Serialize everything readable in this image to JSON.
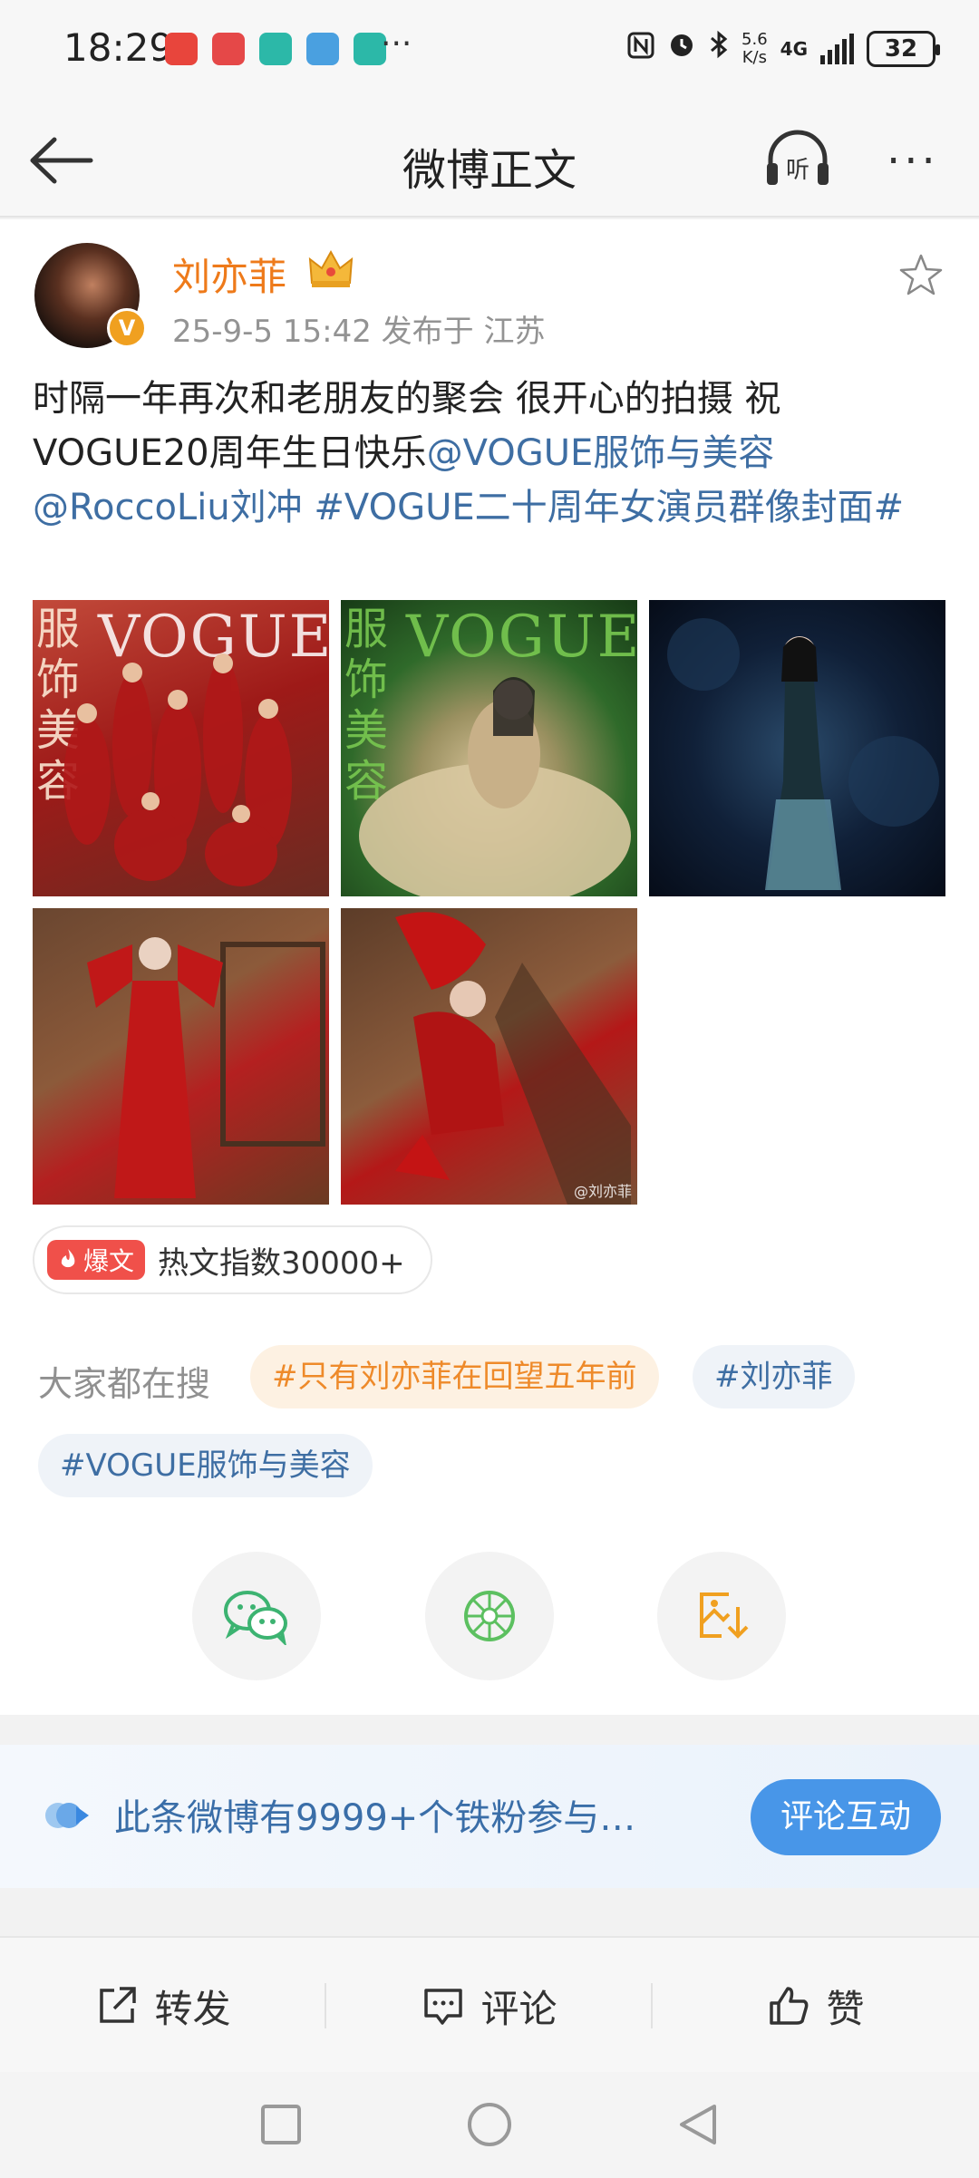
{
  "status_bar": {
    "time": "18:29",
    "more": "···",
    "speed_value": "5.6",
    "speed_unit": "K/s",
    "network": "4G",
    "battery": "32"
  },
  "header": {
    "title": "微博正文",
    "listen_icon": "headphones-icon",
    "listen_label": "听",
    "more": "···"
  },
  "post": {
    "username": "刘亦菲",
    "verified_badge": "V",
    "meta": "25-9-5 15:42  发布于 江苏",
    "text_part1": "时隔一年再次和老朋友的聚会 很开心的拍摄 祝VOGUE20周年生日快乐",
    "mention1": "@VOGUE服饰与美容",
    "mention2": "@RoccoLiu刘冲",
    "topic": "#VOGUE二十周年女演员群像封面#",
    "photos": [
      {
        "vogue": "VOGUE",
        "cn": "服饰美容"
      },
      {
        "vogue": "VOGUE",
        "cn": "服饰美容"
      },
      {},
      {},
      {
        "watermark": "@刘亦菲"
      }
    ],
    "hot_tag": "爆文",
    "hot_text": "热文指数30000+"
  },
  "search": {
    "label": "大家都在搜",
    "tags": [
      "#只有刘亦菲在回望五年前",
      "#刘亦菲",
      "#VOGUE服饰与美容"
    ]
  },
  "share": {
    "icons": [
      "wechat-icon",
      "moments-icon",
      "save-image-icon"
    ]
  },
  "fan_bar": {
    "text": "此条微博有9999+个铁粉参与…",
    "button": "评论互动"
  },
  "actions": {
    "repost": "转发",
    "comment": "评论",
    "like": "赞"
  },
  "colors": {
    "orange_name": "#ee7a1a",
    "link_blue": "#3e6ea3",
    "button_blue": "#4896e8",
    "hot_red": "#f0504a"
  }
}
